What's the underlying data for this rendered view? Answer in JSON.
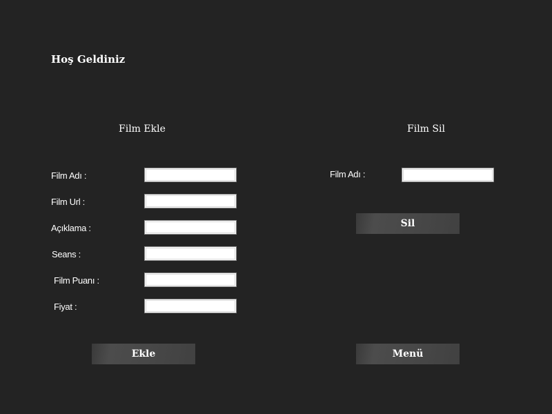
{
  "header": {
    "title": "Hoş Geldiniz"
  },
  "add_form": {
    "heading": "Film Ekle",
    "fields": [
      {
        "label": "Film Adı :",
        "value": ""
      },
      {
        "label": "Film Url :",
        "value": ""
      },
      {
        "label": "Açıklama  :",
        "value": ""
      },
      {
        "label": "Seans :",
        "value": ""
      },
      {
        "label": "Film Puanı :",
        "value": ""
      },
      {
        "label": "Fiyat :",
        "value": ""
      }
    ],
    "submit_label": "Ekle"
  },
  "delete_form": {
    "heading": "Film Sil",
    "field": {
      "label": "Film Adı :",
      "value": ""
    },
    "submit_label": "Sil"
  },
  "menu_label": "Menü",
  "colors": {
    "background": "#232323",
    "button": "#474747",
    "text": "#ffffff"
  }
}
